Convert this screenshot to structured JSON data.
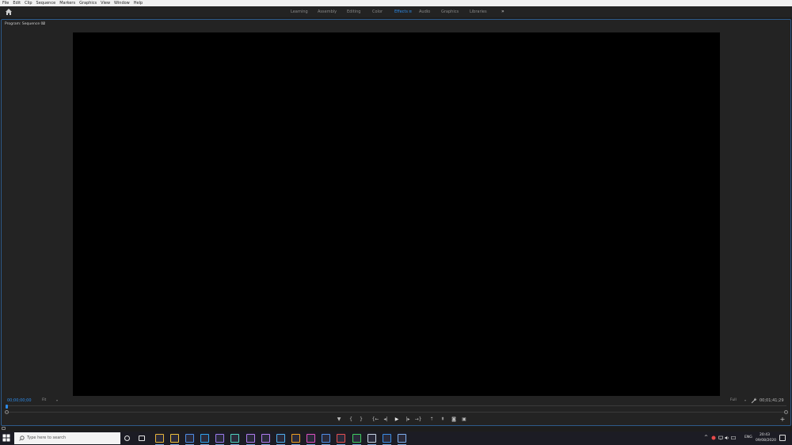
{
  "menu": [
    "File",
    "Edit",
    "Clip",
    "Sequence",
    "Markers",
    "Graphics",
    "View",
    "Window",
    "Help"
  ],
  "workspaces": {
    "tabs": [
      "Learning",
      "Assembly",
      "Editing",
      "Color",
      "Effects",
      "Audio",
      "Graphics",
      "Libraries"
    ],
    "active": "Effects",
    "active_menu_glyph": "≡",
    "overflow_glyph": "»"
  },
  "program_monitor": {
    "title": "Program: Sequence 02",
    "menu_glyph": "≡",
    "timecode_current": "00;00;00;00",
    "zoom_value": "Fit",
    "resolution_value": "Full",
    "timecode_duration": "00;01;41;29"
  },
  "transport": {
    "buttons": [
      {
        "name": "add-marker",
        "glyph": "▼"
      },
      {
        "name": "mark-in",
        "glyph": "{"
      },
      {
        "name": "mark-out",
        "glyph": "}"
      },
      {
        "name": "go-to-in",
        "glyph": "{←"
      },
      {
        "name": "step-back",
        "glyph": "◂|"
      },
      {
        "name": "play",
        "glyph": "▶"
      },
      {
        "name": "step-forward",
        "glyph": "|▸"
      },
      {
        "name": "go-to-out",
        "glyph": "→}"
      },
      {
        "name": "lift",
        "glyph": "⇡"
      },
      {
        "name": "extract",
        "glyph": "⇞"
      },
      {
        "name": "export-frame",
        "glyph": "◙"
      },
      {
        "name": "comparison-view",
        "glyph": "▣"
      }
    ],
    "add_glyph": "+"
  },
  "taskbar": {
    "search_placeholder": "Type here to search",
    "apps": [
      {
        "name": "cortana",
        "color": "#e6e6e6"
      },
      {
        "name": "task-view",
        "color": "#e6e6e6"
      },
      {
        "name": "chrome",
        "color": "#e8b63a"
      },
      {
        "name": "file-explorer",
        "color": "#f0c23b"
      },
      {
        "name": "edge-like-browser",
        "color": "#4f8ee8"
      },
      {
        "name": "photoshop",
        "color": "#2fa3f0"
      },
      {
        "name": "after-effects",
        "color": "#9b7cf0"
      },
      {
        "name": "audition",
        "color": "#4fd4c0"
      },
      {
        "name": "premiere-pro",
        "color": "#b07cf0"
      },
      {
        "name": "media-encoder",
        "color": "#b07cf0"
      },
      {
        "name": "lightroom",
        "color": "#4fb0f0"
      },
      {
        "name": "illustrator",
        "color": "#f0a020"
      },
      {
        "name": "xd",
        "color": "#e050c0"
      },
      {
        "name": "character-animator",
        "color": "#4f8ee8"
      },
      {
        "name": "app-red",
        "color": "#e85050"
      },
      {
        "name": "spotify",
        "color": "#3fcf5f"
      },
      {
        "name": "steam",
        "color": "#c9d6e6"
      },
      {
        "name": "outlook",
        "color": "#3a8ee8"
      },
      {
        "name": "app-blue-round",
        "color": "#7fb0f0"
      }
    ],
    "tray": {
      "language": "ENG",
      "time": "20:43",
      "date": "09/08/2020"
    }
  },
  "colors": {
    "accent": "#2d8ceb",
    "panel_border": "#2e5a8a",
    "video_bg": "#000000",
    "panel_bg": "#232323"
  }
}
